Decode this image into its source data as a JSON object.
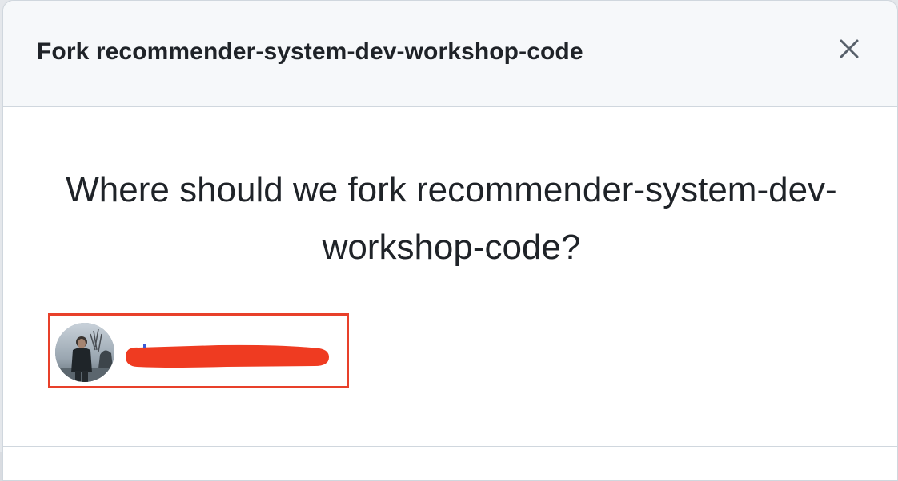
{
  "dialog": {
    "title": "Fork recommender-system-dev-workshop-code",
    "close_icon": "close-icon"
  },
  "body": {
    "question": "Where should we fork recommender-system-dev-workshop-code?"
  },
  "owner_option": {
    "avatar_icon": "user-avatar",
    "name_redacted": true,
    "highlight_color": "#e8402a",
    "redaction_color": "#ef3b21"
  },
  "colors": {
    "header_bg": "#f6f8fa",
    "text": "#1f2328",
    "border": "#d0d7de"
  }
}
